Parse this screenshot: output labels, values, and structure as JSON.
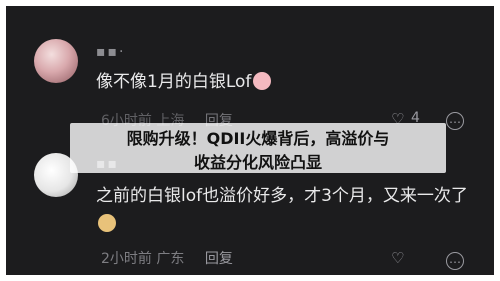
{
  "post": {
    "comment1": {
      "username": "▪▪·",
      "text": "像不像1月的白银Lof",
      "meta_time": "6小时前",
      "meta_location": "上海",
      "reply_label": "回复",
      "like_count": "4"
    },
    "comment2": {
      "username": "▪▪",
      "text": "之前的白银lof也溢价好多，才3个月，又来一次了",
      "meta_time": "2小时前",
      "meta_location": "广东",
      "reply_label": "回复"
    }
  },
  "banner": {
    "line1": "限购升级！QDII火爆背后，高溢价与",
    "line2": "收益分化风险凸显"
  },
  "colors": {
    "background": "#1c1c1e",
    "text": "#e9e9ea",
    "muted": "#7d7d82",
    "banner_bg": "#ffffffcc"
  },
  "icons": [
    "heart-icon",
    "more-icon",
    "emoji-icon"
  ]
}
